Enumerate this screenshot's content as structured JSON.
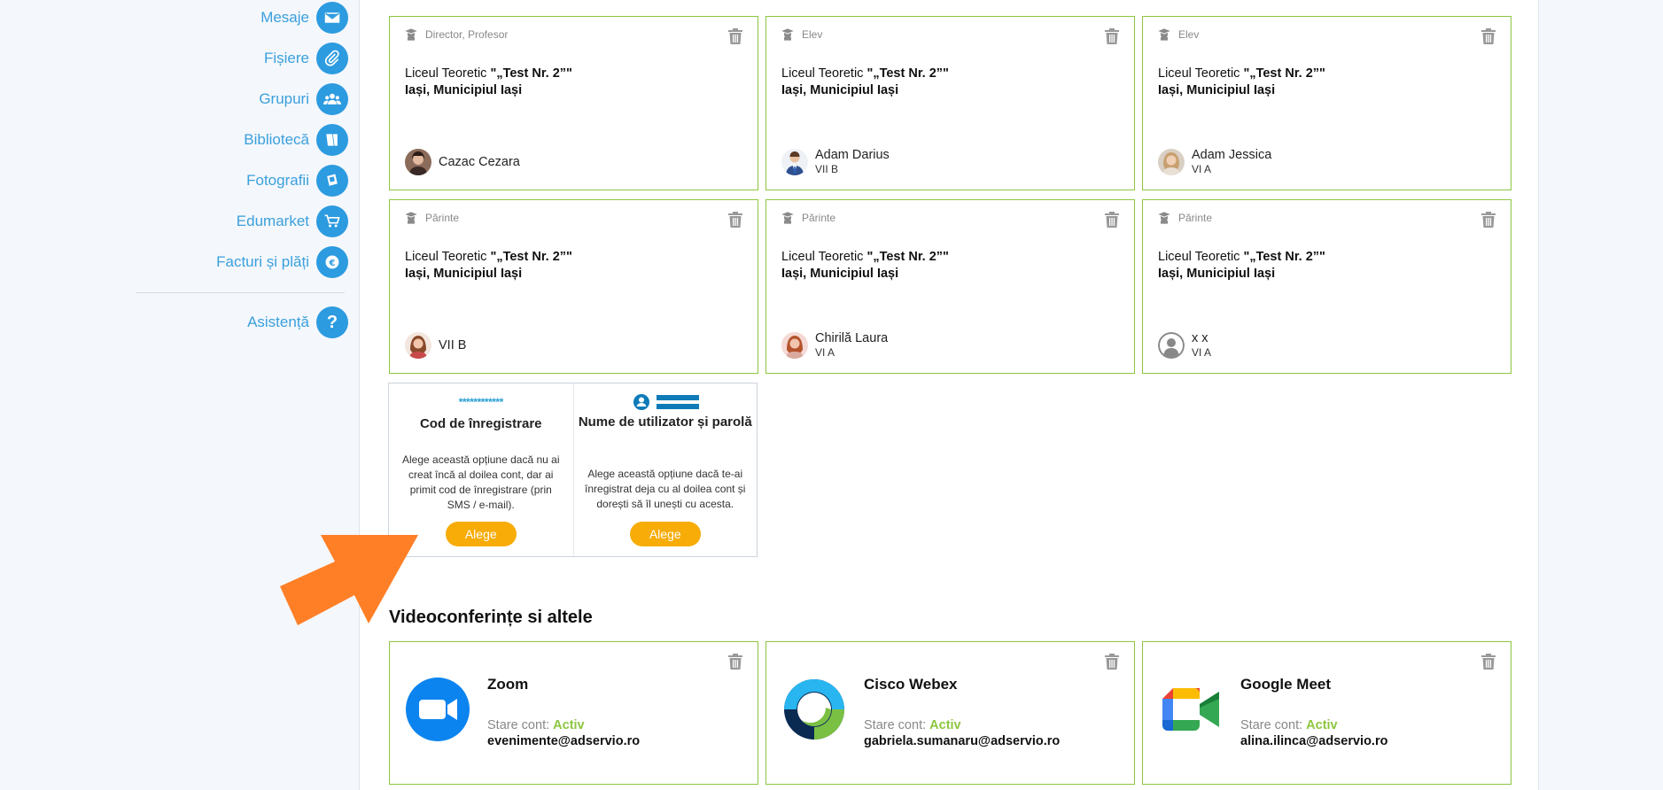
{
  "sidebar": {
    "items": [
      {
        "label": "Mesaje",
        "icon": "envelope-icon"
      },
      {
        "label": "Fișiere",
        "icon": "paperclip-icon"
      },
      {
        "label": "Grupuri",
        "icon": "group-icon"
      },
      {
        "label": "Bibliotecă",
        "icon": "book-icon"
      },
      {
        "label": "Fotografii",
        "icon": "photo-icon"
      },
      {
        "label": "Edumarket",
        "icon": "cart-icon"
      },
      {
        "label": "Facturi și plăți",
        "icon": "euro-icon"
      }
    ],
    "help": {
      "label": "Asistență",
      "icon_text": "?"
    }
  },
  "accounts": [
    {
      "role": "Director, Profesor",
      "school_line1_prefix": "Liceul Teoretic ",
      "school_line1_bold": "\"„Test Nr. 2”\"",
      "school_line2": "Iași, Municipiul Iași",
      "name": "Cazac Cezara",
      "class": ""
    },
    {
      "role": "Elev",
      "school_line1_prefix": "Liceul Teoretic ",
      "school_line1_bold": "\"„Test Nr. 2”\"",
      "school_line2": "Iași, Municipiul Iași",
      "name": "Adam Darius",
      "class": "VII B"
    },
    {
      "role": "Elev",
      "school_line1_prefix": "Liceul Teoretic ",
      "school_line1_bold": "\"„Test Nr. 2”\"",
      "school_line2": "Iași, Municipiul Iași",
      "name": "Adam Jessica",
      "class": "VI A"
    },
    {
      "role": "Părinte",
      "school_line1_prefix": "Liceul Teoretic ",
      "school_line1_bold": "\"„Test Nr. 2”\"",
      "school_line2": "Iași, Municipiul Iași",
      "name": "VII B",
      "class": ""
    },
    {
      "role": "Părinte",
      "school_line1_prefix": "Liceul Teoretic ",
      "school_line1_bold": "\"„Test Nr. 2”\"",
      "school_line2": "Iași, Municipiul Iași",
      "name": "Chirilă Laura",
      "class": "VI A"
    },
    {
      "role": "Părinte",
      "school_line1_prefix": "Liceul Teoretic ",
      "school_line1_bold": "\"„Test Nr. 2”\"",
      "school_line2": "Iași, Municipiul Iași",
      "name": "x x",
      "class": "VI A"
    }
  ],
  "add_account": {
    "code_option": {
      "stars": "************",
      "title": "Cod de înregistrare",
      "description": "Alege această opțiune dacă nu ai creat încă al doilea cont, dar ai primit cod de înregistrare (prin SMS / e-mail).",
      "button": "Alege"
    },
    "login_option": {
      "title": "Nume de utilizator și parolă",
      "description": "Alege această opțiune dacă te-ai înregistrat deja cu al doilea cont și dorești să îl unești cu acesta.",
      "button": "Alege"
    }
  },
  "videoconf": {
    "title": "Videoconferințe si altele",
    "status_label": "Stare cont: ",
    "items": [
      {
        "name": "Zoom",
        "status": "Activ",
        "email": "evenimente@adservio.ro",
        "icon": "zoom-logo-icon"
      },
      {
        "name": "Cisco Webex",
        "status": "Activ",
        "email": "gabriela.sumanaru@adservio.ro",
        "icon": "webex-logo-icon"
      },
      {
        "name": "Google Meet",
        "status": "Activ",
        "email": "alina.ilinca@adservio.ro",
        "icon": "google-meet-logo-icon"
      }
    ]
  },
  "colors": {
    "accent": "#2c9be0",
    "card_border": "#8cc63f",
    "button": "#f7ac08",
    "arrow": "#ff7f27"
  }
}
